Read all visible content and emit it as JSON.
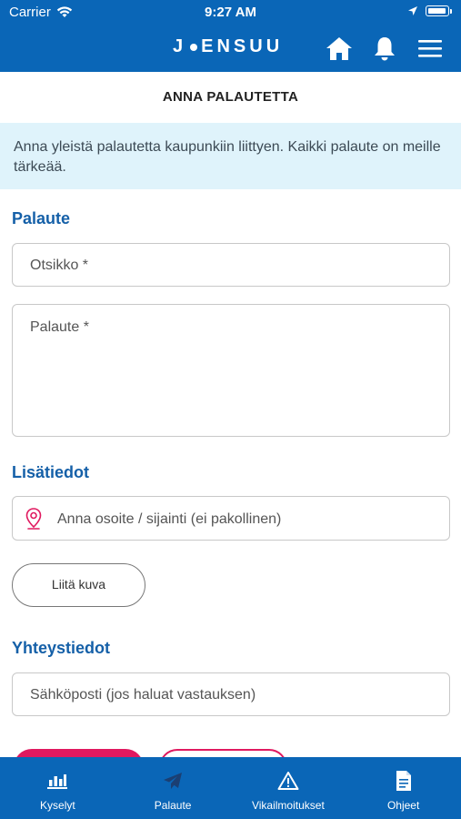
{
  "status_bar": {
    "carrier": "Carrier",
    "time": "9:27 AM"
  },
  "header": {
    "logo_left": "J",
    "logo_right": "ENSUU"
  },
  "page": {
    "title": "ANNA PALAUTETTA",
    "intro": "Anna yleistä palautetta kaupunkiin liittyen. Kaikki palaute on meille tärkeää."
  },
  "sections": {
    "feedback_title": "Palaute",
    "details_title": "Lisätiedot",
    "contact_title": "Yhteystiedot"
  },
  "form": {
    "subject_placeholder": "Otsikko *",
    "feedback_placeholder": "Palaute *",
    "address_placeholder": "Anna osoite / sijainti (ei pakollinen)",
    "attach_label": "Liitä kuva",
    "email_placeholder": "Sähköposti (jos haluat vastauksen)"
  },
  "tabs": [
    {
      "label": "Kyselyt",
      "icon": "bar-chart-icon"
    },
    {
      "label": "Palaute",
      "icon": "paper-plane-icon"
    },
    {
      "label": "Vikailmoitukset",
      "icon": "warning-icon"
    },
    {
      "label": "Ohjeet",
      "icon": "document-icon"
    }
  ],
  "colors": {
    "brand_blue": "#0a66b7",
    "section_blue": "#1560a8",
    "info_bg": "#dff3fb",
    "accent_pink": "#e0195f"
  }
}
